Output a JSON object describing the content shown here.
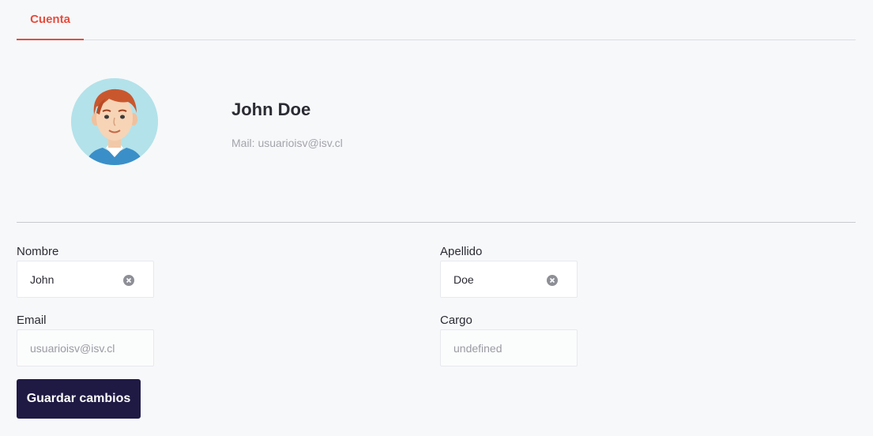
{
  "tabs": [
    {
      "label": "Cuenta",
      "active": true
    }
  ],
  "profile": {
    "name": "John Doe",
    "mail_label": "Mail: ",
    "mail_value": "usuarioisv@isv.cl",
    "avatar_icon": "avatar-cartoon-man-icon"
  },
  "form": {
    "nombre": {
      "label": "Nombre",
      "value": "John",
      "clear_icon": "clear-circle-icon"
    },
    "apellido": {
      "label": "Apellido",
      "value": "Doe",
      "clear_icon": "clear-circle-icon"
    },
    "email": {
      "label": "Email",
      "value": "usuarioisv@isv.cl"
    },
    "cargo": {
      "label": "Cargo",
      "value": "undefined"
    },
    "save_label": "Guardar cambios"
  },
  "colors": {
    "accent": "#e84c3d",
    "button_bg": "#1f1a44",
    "background": "#f7f8fa"
  }
}
